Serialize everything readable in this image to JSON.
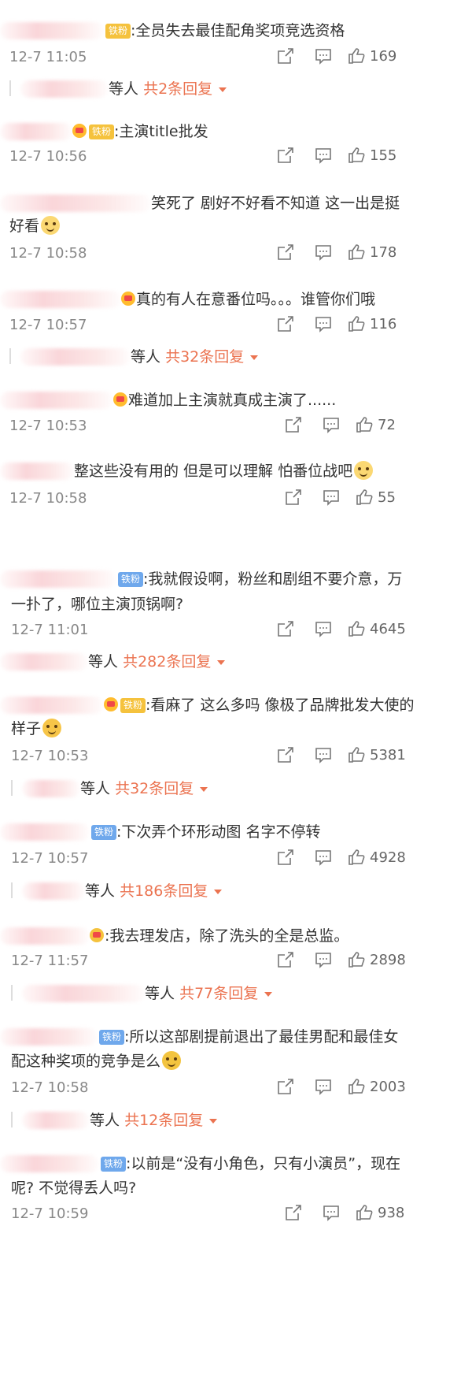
{
  "comments": [
    {
      "text": ":全员失去最佳配角奖项竞选资格",
      "time": "12-7 11:05",
      "likes": "169"
    },
    {
      "text": ":主演title批发",
      "time": "12-7 10:56",
      "likes": "155"
    },
    {
      "text": "笑死了 剧好不好看不知道 这一出是挺",
      "text2": "好看",
      "time": "12-7 10:58",
      "likes": "178"
    },
    {
      "text": "真的有人在意番位吗。。。谁管你们哦",
      "time": "12-7 10:57",
      "likes": "116"
    },
    {
      "text": "难道加上主演就真成主演了......",
      "time": "12-7 10:53",
      "likes": "72"
    },
    {
      "text": "整这些没有用的 但是可以理解 怕番位战吧",
      "time": "12-7 10:58",
      "likes": "55"
    },
    {
      "text": ":我就假设啊，粉丝和剧组不要介意，万",
      "text2": "一扑了，哪位主演顶锅啊?",
      "time": "12-7 11:01",
      "likes": "4645"
    },
    {
      "text": ":看麻了 这么多吗 像极了品牌批发大使的",
      "text2": "样子",
      "time": "12-7 10:53",
      "likes": "5381"
    },
    {
      "text": ":下次弄个环形动图 名字不停转",
      "time": "12-7 10:57",
      "likes": "4928"
    },
    {
      "text": ":我去理发店，除了洗头的全是总监。",
      "time": "12-7 11:57",
      "likes": "2898"
    },
    {
      "text": ":所以这部剧提前退出了最佳男配和最佳女",
      "text2": "配这种奖项的竞争是么",
      "time": "12-7 10:58",
      "likes": "2003"
    },
    {
      "text": ":以前是“没有小角色，只有小演员”，现在",
      "text2": "呢? 不觉得丢人吗?",
      "time": "12-7 10:59",
      "likes": "938"
    }
  ],
  "badge_label": "铁粉",
  "replies": [
    {
      "prefix": "等人",
      "link": "共2条回复"
    },
    {
      "prefix": "等人",
      "link": "共32条回复"
    },
    {
      "prefix": "等人",
      "link": "共282条回复"
    },
    {
      "prefix": "等人",
      "link": "共32条回复"
    },
    {
      "prefix": "等人",
      "link": "共186条回复"
    },
    {
      "prefix": "等人",
      "link": "共77条回复"
    },
    {
      "prefix": "等人",
      "link": "共12条回复"
    }
  ],
  "icons": [
    "share-icon",
    "comment-icon",
    "like-icon"
  ],
  "colors": {
    "accent": "#eb7350",
    "badge_blue": "#6fa8ec",
    "badge_gold": "#f5c23d",
    "meta": "#888888"
  }
}
